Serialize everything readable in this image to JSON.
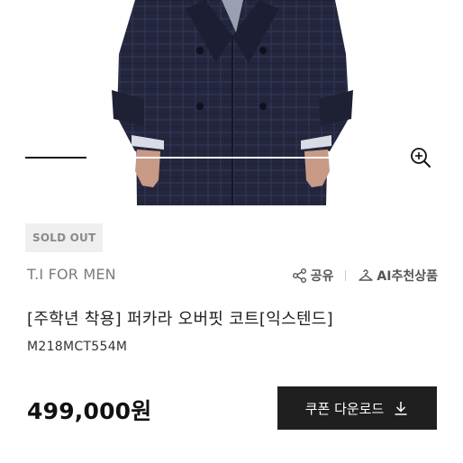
{
  "product": {
    "status_badge": "SOLD OUT",
    "brand": "T.I FOR MEN",
    "title": "[주학년 착용] 퍼카라 오버핏 코트[익스텐드]",
    "code": "M218MCT554M",
    "price": "499,000원"
  },
  "actions": {
    "share_label": "공유",
    "ai_recommend_label": "AI추천상품"
  },
  "coupon": {
    "label": "쿠폰 다운로드"
  },
  "gallery": {
    "active_index": 1,
    "total": 2
  },
  "icons": {
    "zoom": "zoom-in-icon",
    "share": "share-icon",
    "ai": "hanger-icon",
    "download": "download-icon"
  },
  "colors": {
    "coat": "#23263d",
    "badge_bg": "#efefef",
    "button_bg": "#1f1f1f"
  }
}
